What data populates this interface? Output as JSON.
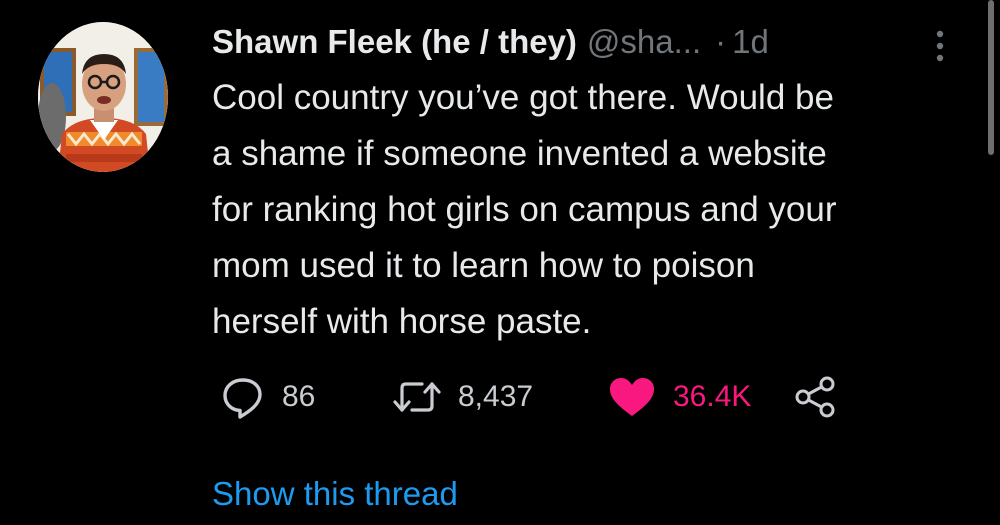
{
  "tweet": {
    "author_name": "Shawn Fleek (he / they)",
    "author_handle": "@sha...",
    "separator": "·",
    "timestamp": "1d",
    "text_lines": [
      "Cool country you’ve got there. Would be",
      "a shame if someone invented a website",
      "for ranking hot girls on campus and your",
      "mom used it to learn how to poison",
      "herself with horse paste."
    ],
    "actions": {
      "reply_count": "86",
      "retweet_count": "8,437",
      "like_count": "36.4K",
      "liked": true
    },
    "show_thread_label": "Show this thread"
  },
  "icons": {
    "avatar": "avatar-photo",
    "more": "more-vertical-icon",
    "reply": "reply-bubble-icon",
    "retweet": "retweet-icon",
    "like": "heart-filled-icon",
    "share": "share-icon"
  },
  "colors": {
    "background": "#000000",
    "text": "#e7e9ea",
    "secondary": "#71767b",
    "link": "#1d9bf0",
    "like": "#f91880"
  }
}
